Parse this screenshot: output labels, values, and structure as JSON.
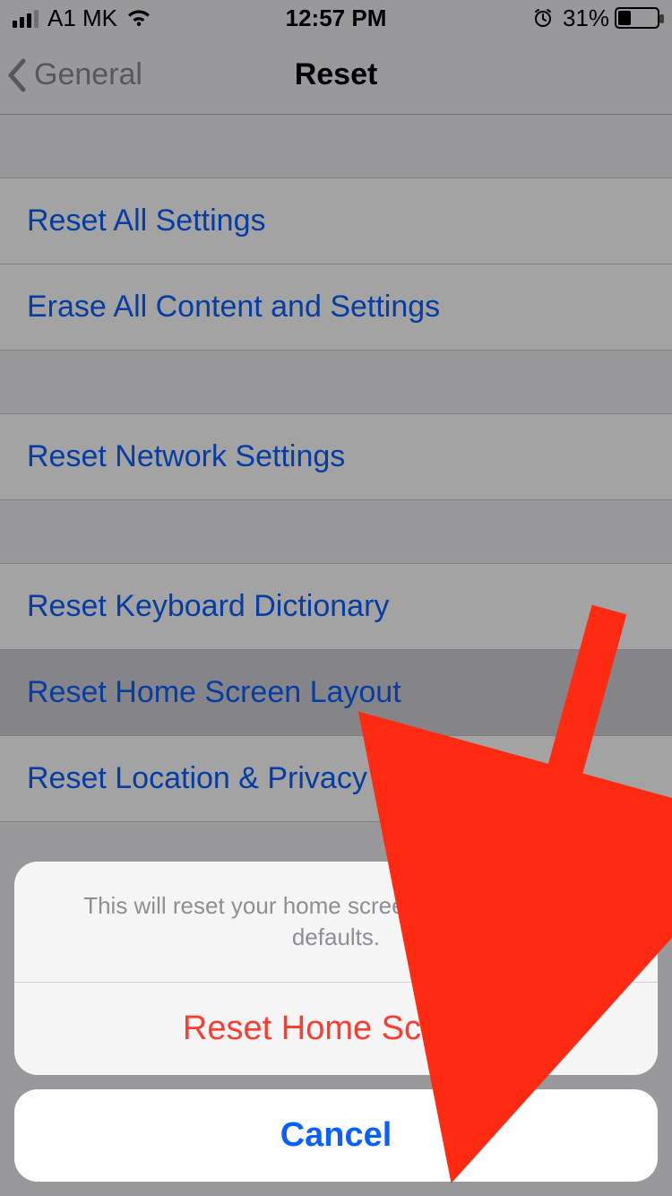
{
  "statusbar": {
    "carrier": "A1 MK",
    "time": "12:57 PM",
    "battery_pct": "31%"
  },
  "nav": {
    "back": "General",
    "title": "Reset"
  },
  "groups": [
    {
      "rows": [
        "Reset All Settings",
        "Erase All Content and Settings"
      ]
    },
    {
      "rows": [
        "Reset Network Settings"
      ]
    },
    {
      "rows": [
        "Reset Keyboard Dictionary",
        "Reset Home Screen Layout",
        "Reset Location & Privacy"
      ],
      "selectedIndex": 1
    }
  ],
  "sheet": {
    "message": "This will reset your home screen layout to factory defaults.",
    "action": "Reset Home Screen",
    "cancel": "Cancel"
  },
  "colors": {
    "link": "#0a60ff",
    "destructive": "#ff3b30",
    "separator": "#c8c7cc",
    "bg": "#efeff4"
  }
}
